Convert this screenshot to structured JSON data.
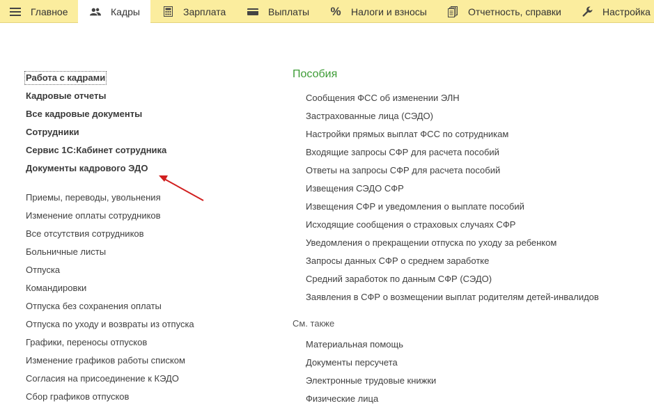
{
  "tabs": [
    {
      "label": "Главное",
      "icon": "hamburger-icon"
    },
    {
      "label": "Кадры",
      "icon": "people-icon",
      "active": true
    },
    {
      "label": "Зарплата",
      "icon": "calculator-icon"
    },
    {
      "label": "Выплаты",
      "icon": "wallet-icon"
    },
    {
      "label": "Налоги и взносы",
      "icon": "percent-icon",
      "glyph": "%"
    },
    {
      "label": "Отчетность, справки",
      "icon": "documents-icon"
    },
    {
      "label": "Настройка",
      "icon": "wrench-icon"
    }
  ],
  "left_bold_links": [
    "Работа с кадрами",
    "Кадровые отчеты",
    "Все кадровые документы",
    "Сотрудники",
    "Сервис 1С:Кабинет сотрудника",
    "Документы кадрового ЭДО"
  ],
  "left_links": [
    "Приемы, переводы, увольнения",
    "Изменение оплаты сотрудников",
    "Все отсутствия сотрудников",
    "Больничные листы",
    "Отпуска",
    "Командировки",
    "Отпуска без сохранения оплаты",
    "Отпуска по уходу и возвраты из отпуска",
    "Графики, переносы отпусков",
    "Изменение графиков работы списком",
    "Согласия на присоединение к КЭДО",
    "Сбор графиков отпусков"
  ],
  "benefits": {
    "title": "Пособия",
    "links": [
      "Сообщения ФСС об изменении ЭЛН",
      "Застрахованные лица (СЭДО)",
      "Настройки прямых выплат ФСС по сотрудникам",
      "Входящие запросы СФР для расчета пособий",
      "Ответы на запросы СФР для расчета пособий",
      "Извещения СЭДО СФР",
      "Извещения СФР и уведомления о выплате пособий",
      "Исходящие сообщения о страховых случаях СФР",
      "Уведомления о прекращении отпуска по уходу за ребенком",
      "Запросы данных СФР о среднем заработке",
      "Средний заработок по данным СФР (СЭДО)",
      "Заявления в СФР о возмещении выплат родителям детей-инвалидов"
    ]
  },
  "see_also": {
    "title": "См. также",
    "links": [
      "Материальная помощь",
      "Документы персучета",
      "Электронные трудовые книжки",
      "Физические лица"
    ]
  },
  "colors": {
    "topbar": "#fbed9e",
    "section_title": "#3d9c36",
    "arrow": "#d11f1f"
  }
}
